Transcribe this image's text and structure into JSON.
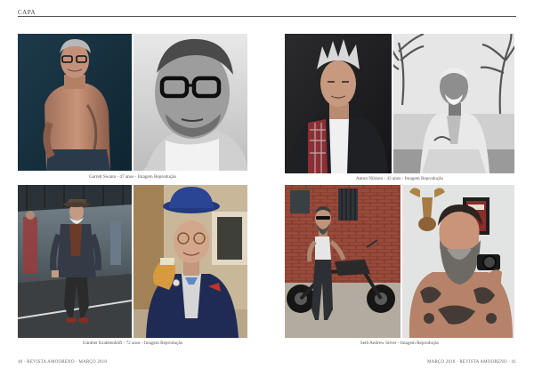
{
  "header": {
    "section": "CAPA"
  },
  "photos": [
    {
      "id": "photo-1",
      "subject": "shirtless man with gray hair and glasses, tattooed arm"
    },
    {
      "id": "photo-2",
      "subject": "black and white close-up of man with black glasses"
    },
    {
      "id": "photo-3",
      "subject": "man with spiky gray hair in plaid shirt"
    },
    {
      "id": "photo-4",
      "subject": "black and white man in light suit seated by palms"
    },
    {
      "id": "photo-5",
      "subject": "elderly man in hat and blazer on train platform"
    },
    {
      "id": "photo-6",
      "subject": "elderly man in blue hat with bowtie and glove"
    },
    {
      "id": "photo-7",
      "subject": "bearded man beside motorcycle near brick wall"
    },
    {
      "id": "photo-8",
      "subject": "tattooed bearded man with camera"
    }
  ],
  "captions": {
    "top_left": "Garrett Swann - 47 anos - Imagem Reprodução",
    "top_right": "Anton Nilsson - 43 anos - Imagem Reprodução",
    "bottom_left": "Günther Krabbenhöft - 72 anos - Imagem Reprodução",
    "bottom_right": "Seth Andrew Silver - Imagem Reprodução"
  },
  "folio": {
    "left": "40 · REVISTA AMOORENO · MARÇO 2018",
    "right": "MARÇO 2018 · REVISTA AMOORENO · 41"
  }
}
